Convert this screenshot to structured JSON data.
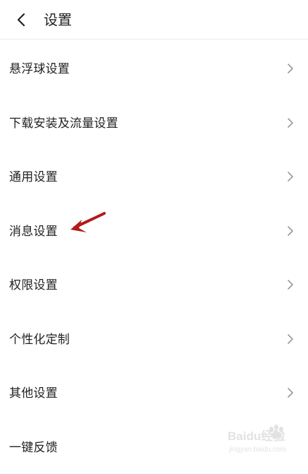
{
  "header": {
    "title": "设置",
    "back_icon": "chevron-left-icon"
  },
  "settings": {
    "items": [
      {
        "label": "悬浮球设置",
        "icon": "chevron-right-icon"
      },
      {
        "label": "下载安装及流量设置",
        "icon": "chevron-right-icon"
      },
      {
        "label": "通用设置",
        "icon": "chevron-right-icon"
      },
      {
        "label": "消息设置",
        "icon": "chevron-right-icon"
      },
      {
        "label": "权限设置",
        "icon": "chevron-right-icon"
      },
      {
        "label": "个性化定制",
        "icon": "chevron-right-icon"
      },
      {
        "label": "其他设置",
        "icon": "chevron-right-icon"
      },
      {
        "label": "一键反馈"
      }
    ]
  },
  "annotation": {
    "icon": "red-arrow-icon",
    "color": "#b01c1c"
  },
  "watermark": {
    "text": "Baidu经验",
    "subtext": "jingyan.baidu.com"
  }
}
